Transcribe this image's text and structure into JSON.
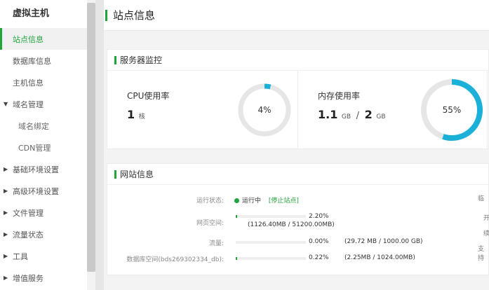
{
  "sidebar": {
    "brand": "虚拟主机",
    "items": [
      {
        "label": "站点信息",
        "active": true
      },
      {
        "label": "数据库信息"
      },
      {
        "label": "主机信息"
      },
      {
        "label": "域名管理",
        "expanded": true
      },
      {
        "label": "域名绑定",
        "sub": true
      },
      {
        "label": "CDN管理",
        "sub": true
      },
      {
        "label": "基础环境设置"
      },
      {
        "label": "高级环境设置"
      },
      {
        "label": "文件管理"
      },
      {
        "label": "流量状态"
      },
      {
        "label": "工具"
      },
      {
        "label": "增值服务"
      }
    ]
  },
  "page": {
    "title": "站点信息"
  },
  "monitor": {
    "title": "服务器监控",
    "cpu": {
      "label": "CPU使用率",
      "value": "1",
      "unit": "核",
      "percent": 4,
      "percent_text": "4%"
    },
    "mem": {
      "label": "内存使用率",
      "used": "1.1",
      "used_unit": "GB",
      "total": "2",
      "total_unit": "GB",
      "percent": 55,
      "percent_text": "55%"
    }
  },
  "site": {
    "title": "网站信息",
    "status_label": "运行状态:",
    "status_value": "运行中",
    "stop_link": "[停止站点]",
    "web_label": "网页空间:",
    "web_percent_text": "2.20%",
    "web_percent": 2.2,
    "web_detail": "(1126.40MB / 51200.00MB)",
    "flow_label": "流量:",
    "flow_percent_text": "0.00%",
    "flow_percent": 0,
    "flow_detail": "(29.72 MB / 1000.00 GB)",
    "db_label": "数据库空间(bds269302334_db):",
    "db_percent_text": "0.22%",
    "db_percent": 0.22,
    "db_detail": "(2.25MB / 1024.00MB)",
    "right_col": [
      "临",
      "开",
      "续",
      "支持"
    ]
  },
  "colors": {
    "accent": "#20a53a",
    "gauge": "#1ab0d8",
    "track": "#e6e6e6"
  }
}
